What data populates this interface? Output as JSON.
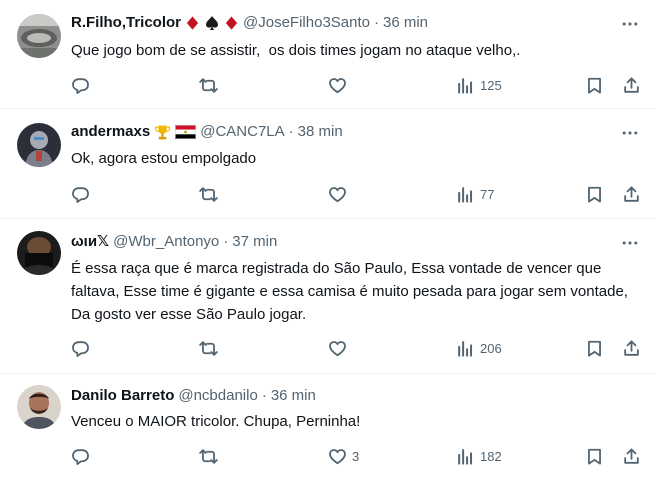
{
  "tweets": [
    {
      "name": "R.Filho,Tricolor",
      "handle": "@JoseFilho3Santo",
      "dot": "·",
      "time": "36 min",
      "text": "Que jogo bom de se assistir,  os dois times jogam no ataque velho,.",
      "likes": "",
      "views": "125",
      "badges": [
        "diamond-suit-emoji",
        "spade-suit-emoji",
        "diamond-suit-emoji"
      ]
    },
    {
      "name": "andermaxs",
      "handle": "@CANC7LA",
      "dot": "·",
      "time": "38 min",
      "text": "Ok, agora estou empolgado",
      "likes": "",
      "views": "77",
      "badges": [
        "trophy-emoji",
        "egypt-flag-emoji"
      ]
    },
    {
      "name": "ωιи𝕏",
      "handle": "@Wbr_Antonyo",
      "dot": "·",
      "time": "37 min",
      "text": "É essa raça que é marca registrada do São Paulo, Essa vontade de vencer que faltava, Esse time é gigante e essa camisa é muito pesada para jogar sem vontade, Da gosto ver esse São Paulo jogar.",
      "likes": "",
      "views": "206",
      "badges": []
    },
    {
      "name": "Danilo Barreto",
      "handle": "@ncbdanilo",
      "dot": "·",
      "time": "36 min",
      "text": "Venceu o MAIOR tricolor. Chupa, Perninha!",
      "likes": "3",
      "views": "182",
      "badges": []
    }
  ],
  "colors": {
    "text": "#0f1419",
    "secondary": "#536471",
    "divider": "#eff3f4",
    "suit_red": "#c1121f"
  },
  "icons": [
    "reply-icon",
    "retweet-icon",
    "like-icon",
    "views-icon",
    "bookmark-icon",
    "share-icon",
    "more-icon"
  ]
}
